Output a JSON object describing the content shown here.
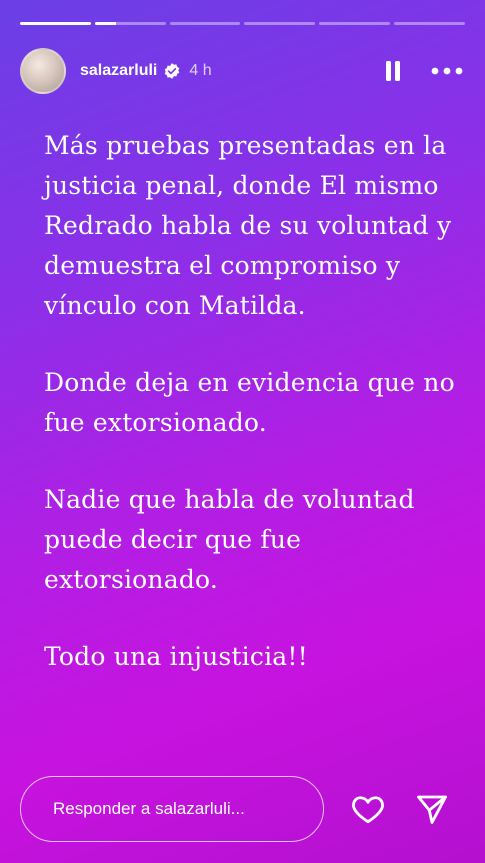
{
  "story": {
    "progress": [
      1,
      0.3,
      0,
      0,
      0,
      0
    ],
    "username": "salazarluli",
    "verified": true,
    "time": "4 h"
  },
  "text": {
    "paragraphs": [
      "Más pruebas presentadas en la justicia penal, donde El mismo Redrado habla de su voluntad y demuestra el compromiso y vínculo con Matilda.",
      "Donde deja en evidencia que no fue extorsionado.",
      "Nadie que habla de voluntad puede decir que fue extorsionado.",
      "Todo una injusticia!!"
    ]
  },
  "reply": {
    "placeholder": "Responder a salazarluli..."
  },
  "icons": {
    "pause": "pause-icon",
    "more": "more-options-icon",
    "like": "heart-icon",
    "share": "send-icon",
    "verified": "verified-badge-icon"
  }
}
